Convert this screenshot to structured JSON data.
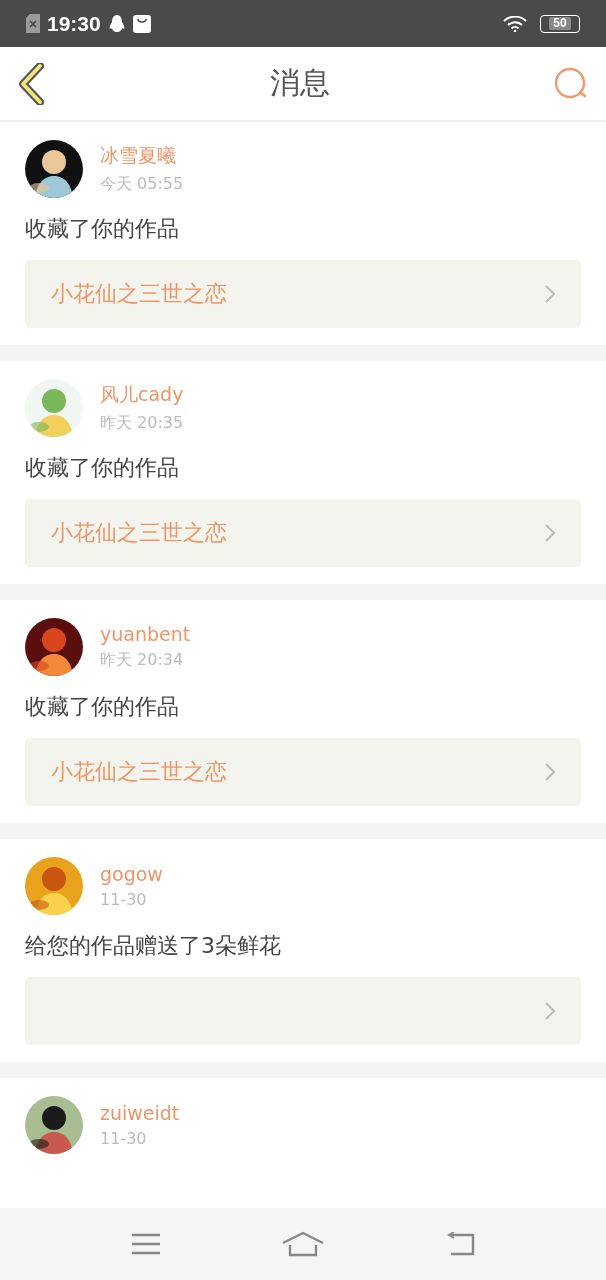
{
  "status_bar": {
    "time": "19:30",
    "battery": "50"
  },
  "header": {
    "title": "消息"
  },
  "messages": [
    {
      "user": "冰雪夏曦",
      "time": "今天 05:55",
      "action": "收藏了你的作品",
      "work_box": true,
      "work_title": "小花仙之三世之恋"
    },
    {
      "user": "风儿cady",
      "time": "昨天 20:35",
      "action": "收藏了你的作品",
      "work_box": true,
      "work_title": "小花仙之三世之恋"
    },
    {
      "user": "yuanbent",
      "time": "昨天 20:34",
      "action": "收藏了你的作品",
      "work_box": true,
      "work_title": "小花仙之三世之恋"
    },
    {
      "user": "gogow",
      "time": "11-30",
      "action": "给您的作品赠送了3朵鲜花",
      "work_box": true
    },
    {
      "user": "zuiweidt",
      "time": "11-30",
      "work_box": false
    }
  ]
}
